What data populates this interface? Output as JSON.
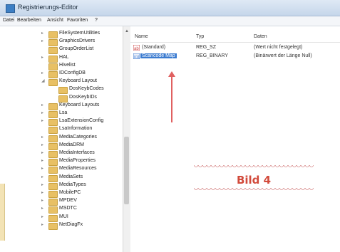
{
  "window": {
    "title": "Registrierungs-Editor"
  },
  "menu": [
    "Datei",
    "Bearbeiten",
    "Ansicht",
    "Favoriten",
    "?"
  ],
  "tree": [
    {
      "label": "FileSystemUtilities",
      "expander": "▸",
      "indent": 0
    },
    {
      "label": "GraphicsDrivers",
      "expander": "▸",
      "indent": 0
    },
    {
      "label": "GroupOrderList",
      "expander": "",
      "indent": 0
    },
    {
      "label": "HAL",
      "expander": "▸",
      "indent": 0
    },
    {
      "label": "Hivelist",
      "expander": "",
      "indent": 0
    },
    {
      "label": "IDConfigDB",
      "expander": "▸",
      "indent": 0
    },
    {
      "label": "Keyboard Layout",
      "expander": "◢",
      "indent": 0
    },
    {
      "label": "DosKeybCodes",
      "expander": "",
      "indent": 1
    },
    {
      "label": "DosKeybIDs",
      "expander": "",
      "indent": 1
    },
    {
      "label": "Keyboard Layouts",
      "expander": "▸",
      "indent": 0
    },
    {
      "label": "Lsa",
      "expander": "▸",
      "indent": 0
    },
    {
      "label": "LsaExtensionConfig",
      "expander": "▸",
      "indent": 0
    },
    {
      "label": "LsaInformation",
      "expander": "",
      "indent": 0
    },
    {
      "label": "MediaCategories",
      "expander": "▸",
      "indent": 0
    },
    {
      "label": "MediaDRM",
      "expander": "▸",
      "indent": 0
    },
    {
      "label": "MediaInterfaces",
      "expander": "▸",
      "indent": 0
    },
    {
      "label": "MediaProperties",
      "expander": "▸",
      "indent": 0
    },
    {
      "label": "MediaResources",
      "expander": "▸",
      "indent": 0
    },
    {
      "label": "MediaSets",
      "expander": "▸",
      "indent": 0
    },
    {
      "label": "MediaTypes",
      "expander": "▸",
      "indent": 0
    },
    {
      "label": "MobilePC",
      "expander": "▸",
      "indent": 0
    },
    {
      "label": "MPDEV",
      "expander": "▸",
      "indent": 0
    },
    {
      "label": "MSDTC",
      "expander": "▸",
      "indent": 0
    },
    {
      "label": "MUI",
      "expander": "▸",
      "indent": 0
    },
    {
      "label": "NetDiagFx",
      "expander": "▸",
      "indent": 0
    }
  ],
  "list": {
    "columns": {
      "name": "Name",
      "type": "Typ",
      "data": "Daten"
    },
    "rows": [
      {
        "name": "(Standard)",
        "type": "REG_SZ",
        "data": "(Wert nicht festgelegt)",
        "icon": "string-value-icon"
      },
      {
        "name": "Scancode Map",
        "type": "REG_BINARY",
        "data": "(Binärwert der Länge Null)",
        "icon": "binary-value-icon"
      }
    ]
  },
  "annotation": {
    "label": "Bild 4",
    "color": "#d24a3b"
  }
}
